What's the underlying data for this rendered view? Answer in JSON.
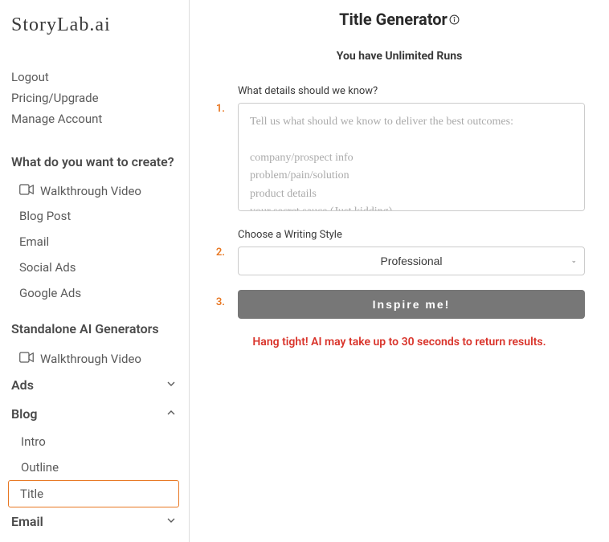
{
  "logo": "StoryLab.ai",
  "account": {
    "logout": "Logout",
    "pricing": "Pricing/Upgrade",
    "manage": "Manage Account"
  },
  "create_heading": "What do you want to create?",
  "walkthrough_label": "Walkthrough Video",
  "create_items": {
    "blog_post": "Blog Post",
    "email": "Email",
    "social_ads": "Social Ads",
    "google_ads": "Google Ads"
  },
  "standalone_heading": "Standalone AI Generators",
  "groups": {
    "ads": "Ads",
    "blog": "Blog",
    "email": "Email"
  },
  "blog_items": {
    "intro": "Intro",
    "outline": "Outline",
    "title": "Title"
  },
  "page": {
    "title": "Title Generator",
    "runs": "You have Unlimited Runs"
  },
  "form": {
    "details_label": "What details should we know?",
    "details_placeholder": "Tell us what should we know to deliver the best outcomes:\n\ncompany/prospect info\nproblem/pain/solution\nproduct details\nyour secret sauce (Just kidding)",
    "style_label": "Choose a Writing Style",
    "style_value": "Professional",
    "button": "Inspire me!",
    "wait_msg": "Hang tight! AI may take up to 30 seconds to return results."
  },
  "steps": {
    "one": "1.",
    "two": "2.",
    "three": "3."
  }
}
